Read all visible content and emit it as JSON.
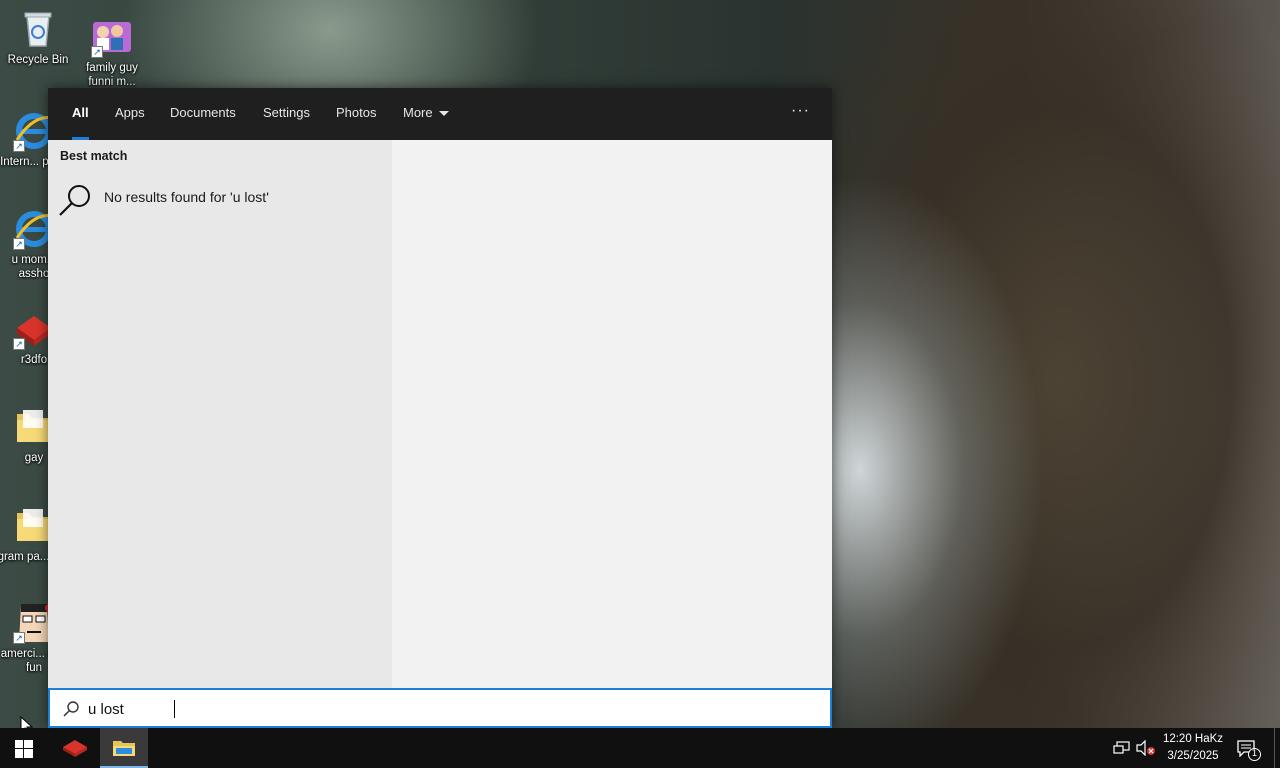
{
  "desktop": {
    "icons": [
      {
        "label": "Recycle Bin",
        "icon": "recycle-bin-icon"
      },
      {
        "label": "family guy funni m...",
        "icon": "family-guy-shortcut-icon"
      },
      {
        "label": "Intern... poop",
        "icon": "internet-explorer-icon"
      },
      {
        "label": "u mom... assho",
        "icon": "internet-explorer-icon"
      },
      {
        "label": "r3dfo",
        "icon": "r3dfox-icon"
      },
      {
        "label": "gay",
        "icon": "folder-icon"
      },
      {
        "label": "gram pa... ass",
        "icon": "folder-icon"
      },
      {
        "label": "amerci... dad fun",
        "icon": "american-dad-shortcut-icon"
      }
    ]
  },
  "search": {
    "tabs": [
      {
        "label": "All",
        "active": true
      },
      {
        "label": "Apps"
      },
      {
        "label": "Documents"
      },
      {
        "label": "Settings"
      },
      {
        "label": "Photos"
      },
      {
        "label": "More"
      }
    ],
    "overflow": "···",
    "best_match_label": "Best match",
    "no_results_text": "No results found for 'u lost'",
    "query": "u lost",
    "accent": "#1a80d8"
  },
  "taskbar": {
    "apps": [
      "start-icon",
      "r3dfox-icon",
      "file-explorer-icon"
    ],
    "clock_time": "12:20 HaKz",
    "clock_date": "3/25/2025",
    "notification_count": "1"
  }
}
